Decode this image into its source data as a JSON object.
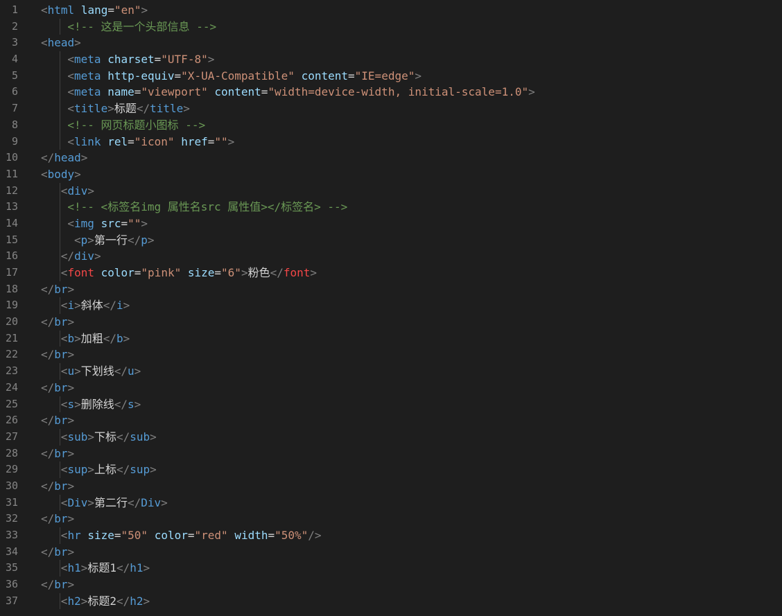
{
  "editor": {
    "lines": [
      {
        "n": "1",
        "indent": 0,
        "guides": 0,
        "tokens": [
          [
            "p",
            "<"
          ],
          [
            "t",
            "html"
          ],
          [
            "s",
            " "
          ],
          [
            "a",
            "lang"
          ],
          [
            "x",
            "="
          ],
          [
            "v",
            "\"en\""
          ],
          [
            "p",
            ">"
          ]
        ]
      },
      {
        "n": "2",
        "indent": 4,
        "guides": 1,
        "tokens": [
          [
            "c",
            "<!-- 这是一个头部信息 -->"
          ]
        ]
      },
      {
        "n": "3",
        "indent": 0,
        "guides": 0,
        "tokens": [
          [
            "p",
            "<"
          ],
          [
            "t",
            "head"
          ],
          [
            "p",
            ">"
          ]
        ]
      },
      {
        "n": "4",
        "indent": 4,
        "guides": 1,
        "tokens": [
          [
            "p",
            "<"
          ],
          [
            "t",
            "meta"
          ],
          [
            "s",
            " "
          ],
          [
            "a",
            "charset"
          ],
          [
            "x",
            "="
          ],
          [
            "v",
            "\"UTF-8\""
          ],
          [
            "p",
            ">"
          ]
        ]
      },
      {
        "n": "5",
        "indent": 4,
        "guides": 1,
        "tokens": [
          [
            "p",
            "<"
          ],
          [
            "t",
            "meta"
          ],
          [
            "s",
            " "
          ],
          [
            "a",
            "http-equiv"
          ],
          [
            "x",
            "="
          ],
          [
            "v",
            "\"X-UA-Compatible\""
          ],
          [
            "s",
            " "
          ],
          [
            "a",
            "content"
          ],
          [
            "x",
            "="
          ],
          [
            "v",
            "\"IE=edge\""
          ],
          [
            "p",
            ">"
          ]
        ]
      },
      {
        "n": "6",
        "indent": 4,
        "guides": 1,
        "tokens": [
          [
            "p",
            "<"
          ],
          [
            "t",
            "meta"
          ],
          [
            "s",
            " "
          ],
          [
            "a",
            "name"
          ],
          [
            "x",
            "="
          ],
          [
            "v",
            "\"viewport\""
          ],
          [
            "s",
            " "
          ],
          [
            "a",
            "content"
          ],
          [
            "x",
            "="
          ],
          [
            "v",
            "\"width=device-width, initial-scale=1.0\""
          ],
          [
            "p",
            ">"
          ]
        ]
      },
      {
        "n": "7",
        "indent": 4,
        "guides": 1,
        "tokens": [
          [
            "p",
            "<"
          ],
          [
            "t",
            "title"
          ],
          [
            "p",
            ">"
          ],
          [
            "x",
            "标题"
          ],
          [
            "p",
            "</"
          ],
          [
            "t",
            "title"
          ],
          [
            "p",
            ">"
          ]
        ]
      },
      {
        "n": "8",
        "indent": 4,
        "guides": 1,
        "tokens": [
          [
            "c",
            "<!-- 网页标题小图标 -->"
          ]
        ]
      },
      {
        "n": "9",
        "indent": 4,
        "guides": 1,
        "tokens": [
          [
            "p",
            "<"
          ],
          [
            "t",
            "link"
          ],
          [
            "s",
            " "
          ],
          [
            "a",
            "rel"
          ],
          [
            "x",
            "="
          ],
          [
            "v",
            "\"icon\""
          ],
          [
            "s",
            " "
          ],
          [
            "a",
            "href"
          ],
          [
            "x",
            "="
          ],
          [
            "v",
            "\"\""
          ],
          [
            "p",
            ">"
          ]
        ]
      },
      {
        "n": "10",
        "indent": 0,
        "guides": 0,
        "tokens": [
          [
            "p",
            "</"
          ],
          [
            "t",
            "head"
          ],
          [
            "p",
            ">"
          ]
        ]
      },
      {
        "n": "11",
        "indent": 0,
        "guides": 0,
        "tokens": [
          [
            "p",
            "<"
          ],
          [
            "t",
            "body"
          ],
          [
            "p",
            ">"
          ]
        ]
      },
      {
        "n": "12",
        "indent": 3,
        "guides": 1,
        "tokens": [
          [
            "p",
            "<"
          ],
          [
            "t",
            "div"
          ],
          [
            "p",
            ">"
          ]
        ]
      },
      {
        "n": "13",
        "indent": 4,
        "guides": 1,
        "tokens": [
          [
            "c",
            "<!-- <标签名img 属性名src 属性值></标签名> -->"
          ]
        ]
      },
      {
        "n": "14",
        "indent": 4,
        "guides": 1,
        "tokens": [
          [
            "p",
            "<"
          ],
          [
            "t",
            "img"
          ],
          [
            "s",
            " "
          ],
          [
            "a",
            "src"
          ],
          [
            "x",
            "="
          ],
          [
            "v",
            "\"\""
          ],
          [
            "p",
            ">"
          ]
        ]
      },
      {
        "n": "15",
        "indent": 5,
        "guides": 1,
        "tokens": [
          [
            "p",
            "<"
          ],
          [
            "t",
            "p"
          ],
          [
            "p",
            ">"
          ],
          [
            "x",
            "第一行"
          ],
          [
            "p",
            "</"
          ],
          [
            "t",
            "p"
          ],
          [
            "p",
            ">"
          ]
        ]
      },
      {
        "n": "16",
        "indent": 3,
        "guides": 1,
        "tokens": [
          [
            "p",
            "</"
          ],
          [
            "t",
            "div"
          ],
          [
            "p",
            ">"
          ]
        ]
      },
      {
        "n": "17",
        "indent": 3,
        "guides": 1,
        "tokens": [
          [
            "p",
            "<"
          ],
          [
            "r",
            "font"
          ],
          [
            "s",
            " "
          ],
          [
            "a",
            "color"
          ],
          [
            "x",
            "="
          ],
          [
            "v",
            "\"pink\""
          ],
          [
            "s",
            " "
          ],
          [
            "a",
            "size"
          ],
          [
            "x",
            "="
          ],
          [
            "v",
            "\"6\""
          ],
          [
            "p",
            ">"
          ],
          [
            "x",
            "粉色"
          ],
          [
            "p",
            "</"
          ],
          [
            "r",
            "font"
          ],
          [
            "p",
            ">"
          ]
        ]
      },
      {
        "n": "18",
        "indent": 0,
        "guides": 0,
        "tokens": [
          [
            "p",
            "</"
          ],
          [
            "t",
            "br"
          ],
          [
            "p",
            ">"
          ]
        ]
      },
      {
        "n": "19",
        "indent": 3,
        "guides": 1,
        "tokens": [
          [
            "p",
            "<"
          ],
          [
            "t",
            "i"
          ],
          [
            "p",
            ">"
          ],
          [
            "x",
            "斜体"
          ],
          [
            "p",
            "</"
          ],
          [
            "t",
            "i"
          ],
          [
            "p",
            ">"
          ]
        ]
      },
      {
        "n": "20",
        "indent": 0,
        "guides": 0,
        "tokens": [
          [
            "p",
            "</"
          ],
          [
            "t",
            "br"
          ],
          [
            "p",
            ">"
          ]
        ]
      },
      {
        "n": "21",
        "indent": 3,
        "guides": 1,
        "tokens": [
          [
            "p",
            "<"
          ],
          [
            "t",
            "b"
          ],
          [
            "p",
            ">"
          ],
          [
            "x",
            "加粗"
          ],
          [
            "p",
            "</"
          ],
          [
            "t",
            "b"
          ],
          [
            "p",
            ">"
          ]
        ]
      },
      {
        "n": "22",
        "indent": 0,
        "guides": 0,
        "tokens": [
          [
            "p",
            "</"
          ],
          [
            "t",
            "br"
          ],
          [
            "p",
            ">"
          ]
        ]
      },
      {
        "n": "23",
        "indent": 3,
        "guides": 1,
        "tokens": [
          [
            "p",
            "<"
          ],
          [
            "t",
            "u"
          ],
          [
            "p",
            ">"
          ],
          [
            "x",
            "下划线"
          ],
          [
            "p",
            "</"
          ],
          [
            "t",
            "u"
          ],
          [
            "p",
            ">"
          ]
        ]
      },
      {
        "n": "24",
        "indent": 0,
        "guides": 0,
        "tokens": [
          [
            "p",
            "</"
          ],
          [
            "t",
            "br"
          ],
          [
            "p",
            ">"
          ]
        ]
      },
      {
        "n": "25",
        "indent": 3,
        "guides": 1,
        "tokens": [
          [
            "p",
            "<"
          ],
          [
            "t",
            "s"
          ],
          [
            "p",
            ">"
          ],
          [
            "x",
            "删除线"
          ],
          [
            "p",
            "</"
          ],
          [
            "t",
            "s"
          ],
          [
            "p",
            ">"
          ]
        ]
      },
      {
        "n": "26",
        "indent": 0,
        "guides": 0,
        "tokens": [
          [
            "p",
            "</"
          ],
          [
            "t",
            "br"
          ],
          [
            "p",
            ">"
          ]
        ]
      },
      {
        "n": "27",
        "indent": 3,
        "guides": 1,
        "tokens": [
          [
            "p",
            "<"
          ],
          [
            "t",
            "sub"
          ],
          [
            "p",
            ">"
          ],
          [
            "x",
            "下标"
          ],
          [
            "p",
            "</"
          ],
          [
            "t",
            "sub"
          ],
          [
            "p",
            ">"
          ]
        ]
      },
      {
        "n": "28",
        "indent": 0,
        "guides": 0,
        "tokens": [
          [
            "p",
            "</"
          ],
          [
            "t",
            "br"
          ],
          [
            "p",
            ">"
          ]
        ]
      },
      {
        "n": "29",
        "indent": 3,
        "guides": 1,
        "tokens": [
          [
            "p",
            "<"
          ],
          [
            "t",
            "sup"
          ],
          [
            "p",
            ">"
          ],
          [
            "x",
            "上标"
          ],
          [
            "p",
            "</"
          ],
          [
            "t",
            "sup"
          ],
          [
            "p",
            ">"
          ]
        ]
      },
      {
        "n": "30",
        "indent": 0,
        "guides": 0,
        "tokens": [
          [
            "p",
            "</"
          ],
          [
            "t",
            "br"
          ],
          [
            "p",
            ">"
          ]
        ]
      },
      {
        "n": "31",
        "indent": 3,
        "guides": 1,
        "tokens": [
          [
            "p",
            "<"
          ],
          [
            "t",
            "Div"
          ],
          [
            "p",
            ">"
          ],
          [
            "x",
            "第二行"
          ],
          [
            "p",
            "</"
          ],
          [
            "t",
            "Div"
          ],
          [
            "p",
            ">"
          ]
        ]
      },
      {
        "n": "32",
        "indent": 0,
        "guides": 0,
        "tokens": [
          [
            "p",
            "</"
          ],
          [
            "t",
            "br"
          ],
          [
            "p",
            ">"
          ]
        ]
      },
      {
        "n": "33",
        "indent": 3,
        "guides": 1,
        "tokens": [
          [
            "p",
            "<"
          ],
          [
            "t",
            "hr"
          ],
          [
            "s",
            " "
          ],
          [
            "a",
            "size"
          ],
          [
            "x",
            "="
          ],
          [
            "v",
            "\"50\""
          ],
          [
            "s",
            " "
          ],
          [
            "a",
            "color"
          ],
          [
            "x",
            "="
          ],
          [
            "v",
            "\"red\""
          ],
          [
            "s",
            " "
          ],
          [
            "a",
            "width"
          ],
          [
            "x",
            "="
          ],
          [
            "v",
            "\"50%\""
          ],
          [
            "p",
            "/>"
          ]
        ]
      },
      {
        "n": "34",
        "indent": 0,
        "guides": 0,
        "tokens": [
          [
            "p",
            "</"
          ],
          [
            "t",
            "br"
          ],
          [
            "p",
            ">"
          ]
        ]
      },
      {
        "n": "35",
        "indent": 3,
        "guides": 1,
        "tokens": [
          [
            "p",
            "<"
          ],
          [
            "t",
            "h1"
          ],
          [
            "p",
            ">"
          ],
          [
            "x",
            "标题1"
          ],
          [
            "p",
            "</"
          ],
          [
            "t",
            "h1"
          ],
          [
            "p",
            ">"
          ]
        ]
      },
      {
        "n": "36",
        "indent": 0,
        "guides": 0,
        "tokens": [
          [
            "p",
            "</"
          ],
          [
            "t",
            "br"
          ],
          [
            "p",
            ">"
          ]
        ]
      },
      {
        "n": "37",
        "indent": 3,
        "guides": 1,
        "tokens": [
          [
            "p",
            "<"
          ],
          [
            "t",
            "h2"
          ],
          [
            "p",
            ">"
          ],
          [
            "x",
            "标题2"
          ],
          [
            "p",
            "</"
          ],
          [
            "t",
            "h2"
          ],
          [
            "p",
            ">"
          ]
        ]
      }
    ],
    "colors": {
      "background": "#1e1e1e",
      "line_number": "#858585",
      "tag": "#569cd6",
      "tag_special": "#f44747",
      "attribute": "#9cdcfe",
      "string": "#ce9178",
      "comment": "#6a9955",
      "text": "#d4d4d4",
      "punctuation": "#808080"
    }
  }
}
